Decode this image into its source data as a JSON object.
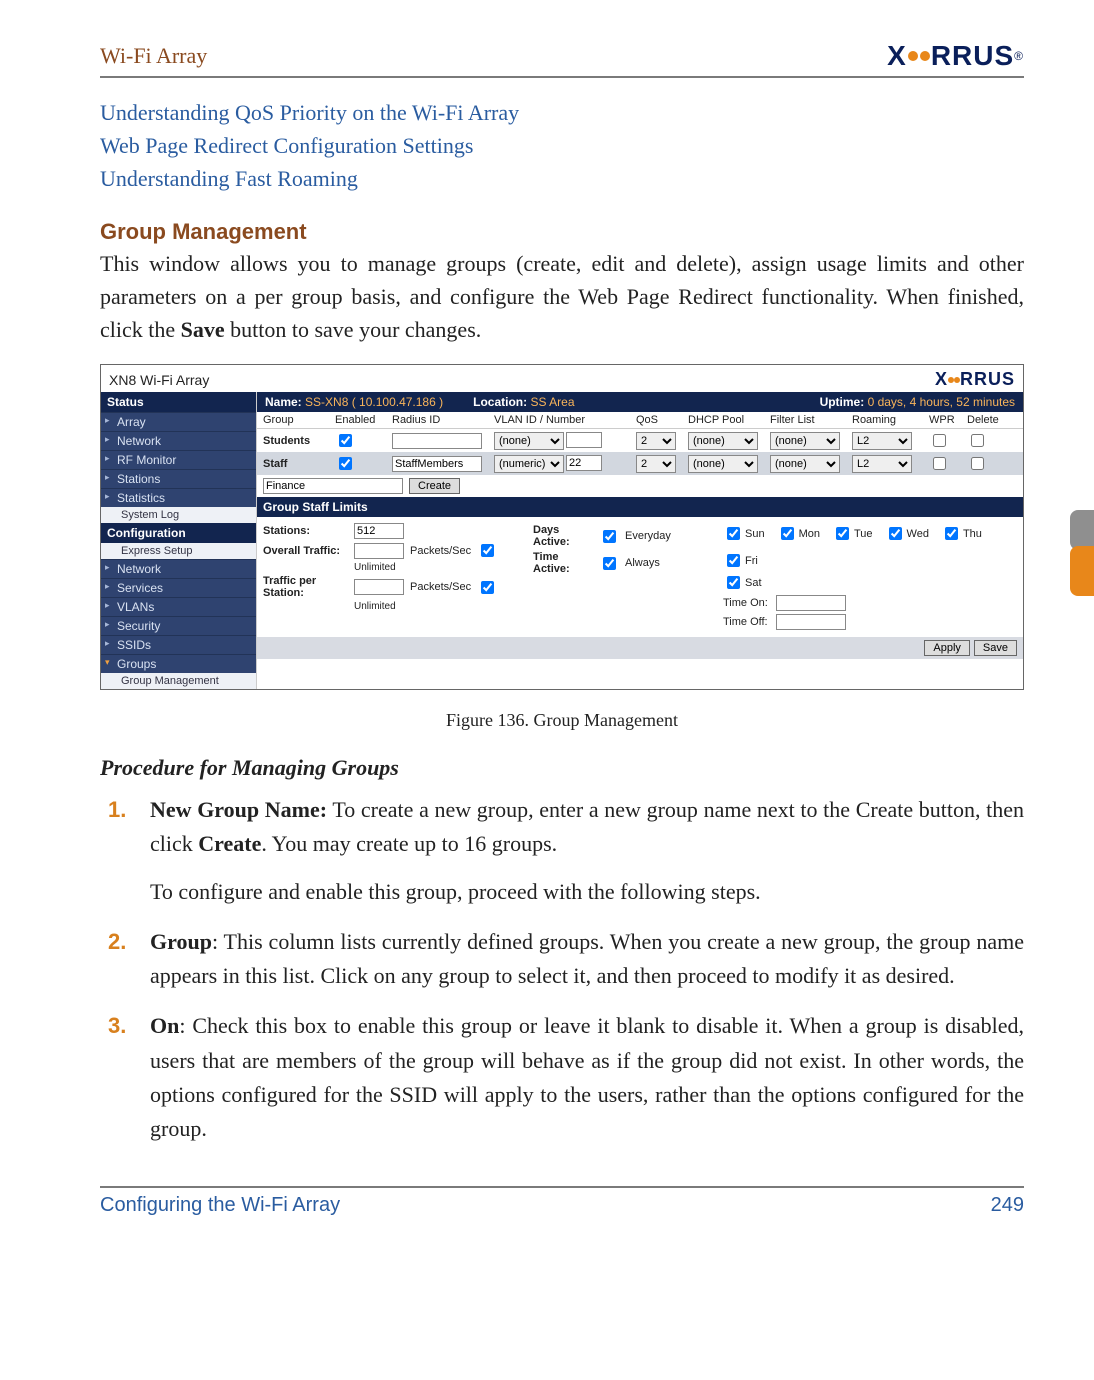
{
  "header": {
    "title": "Wi-Fi Array",
    "brand": "XIRRUS"
  },
  "links": {
    "l1": "Understanding QoS Priority on the Wi-Fi Array",
    "l2": "Web Page Redirect Configuration Settings",
    "l3": "Understanding Fast Roaming"
  },
  "section": {
    "heading": "Group Management",
    "para": "This window allows you to manage groups (create, edit and delete), assign usage limits and other parameters on a per group basis, and configure the Web Page Redirect functionality. When finished, click the ",
    "save_bold": "Save",
    "para_tail": " button to save your changes."
  },
  "screenshot": {
    "window_title": "XN8 Wi-Fi Array",
    "brand": "XIRRUS",
    "sidebar": {
      "status": "Status",
      "items1": [
        "Array",
        "Network",
        "RF Monitor",
        "Stations",
        "Statistics"
      ],
      "syslog": "System Log",
      "config": "Configuration",
      "items2": [
        "Express Setup",
        "Network",
        "Services",
        "VLANs",
        "Security",
        "SSIDs",
        "Groups"
      ],
      "sub": "Group Management"
    },
    "infobar": {
      "name_lbl": "Name:",
      "name_val": "SS-XN8   ( 10.100.47.186 )",
      "loc_lbl": "Location:",
      "loc_val": "SS Area",
      "up_lbl": "Uptime:",
      "up_val": "0 days, 4 hours, 52 minutes"
    },
    "cols": [
      "Group",
      "Enabled",
      "Radius ID",
      "VLAN ID / Number",
      "QoS",
      "DHCP Pool",
      "Filter List",
      "Roaming",
      "WPR",
      "Delete"
    ],
    "rows": [
      {
        "group": "Students",
        "enabled": true,
        "radius": "",
        "vlan_type": "(none)",
        "vlan_num": "",
        "qos": "2",
        "dhcp": "(none)",
        "filter": "(none)",
        "roam": "L2",
        "wpr": false,
        "del": false
      },
      {
        "group": "Staff",
        "enabled": true,
        "radius": "StaffMembers",
        "vlan_type": "(numeric)",
        "vlan_num": "22",
        "qos": "2",
        "dhcp": "(none)",
        "filter": "(none)",
        "roam": "L2",
        "wpr": false,
        "del": false
      }
    ],
    "create": {
      "value": "Finance",
      "btn": "Create"
    },
    "limits": {
      "title": "Group Staff  Limits",
      "stations_lbl": "Stations:",
      "stations_val": "512",
      "overall_lbl": "Overall Traffic:",
      "overall_unit": "Packets/Sec",
      "overall_unl": "Unlimited",
      "per_lbl": "Traffic per Station:",
      "per_unit": "Packets/Sec",
      "per_unl": "Unlimited",
      "days_lbl": "Days Active:",
      "everyday": "Everyday",
      "time_lbl": "Time Active:",
      "always": "Always",
      "days": [
        "Sun",
        "Mon",
        "Tue",
        "Wed",
        "Thu",
        "Fri",
        "Sat"
      ],
      "timeon_lbl": "Time On:",
      "timeoff_lbl": "Time Off:"
    },
    "buttons": {
      "apply": "Apply",
      "save": "Save"
    }
  },
  "figure_caption": "Figure 136. Group Management",
  "subheading": "Procedure for Managing Groups",
  "steps": {
    "s1": {
      "num": "1.",
      "head": "New Group Name:",
      "tail": " To create a new group, enter a new group name next to the Create button, then click ",
      "bold": "Create",
      "tail2": ". You may create up to 16 groups.",
      "p2": "To configure and enable this group, proceed with the following steps."
    },
    "s2": {
      "num": "2.",
      "head": "Group",
      "tail": ": This column lists currently defined groups. When you create a new group, the group name appears in this list. Click on any group to select it, and then proceed to modify it as desired."
    },
    "s3": {
      "num": "3.",
      "head": "On",
      "tail": ": Check this box to enable this group or leave it blank to disable it. When a group is disabled, users that are members of the group will behave as if the group did not exist. In other words, the options configured for the SSID will apply to the users, rather than the options configured for the group."
    }
  },
  "footer": {
    "left": "Configuring the Wi-Fi Array",
    "right": "249"
  }
}
